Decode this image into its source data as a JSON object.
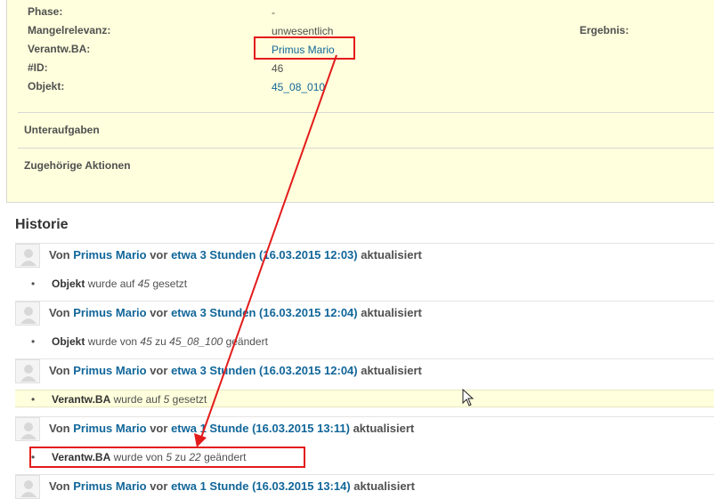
{
  "attributes": {
    "phase": {
      "label": "Phase:",
      "value": "-"
    },
    "mangelrelevanz": {
      "label": "Mangelrelevanz:",
      "value": "unwesentlich"
    },
    "ergebnis": {
      "label": "Ergebnis:"
    },
    "verantw": {
      "label": "Verantw.BA:",
      "value": "Primus Mario"
    },
    "id": {
      "label": "#ID:",
      "value": "46"
    },
    "objekt": {
      "label": "Objekt:",
      "value": "45_08_010"
    }
  },
  "sections": {
    "unteraufgaben": "Unteraufgaben",
    "zugehoerige_aktionen": "Zugehörige Aktionen"
  },
  "historie": {
    "title": "Historie",
    "entries": [
      {
        "prefix": "Von",
        "author": "Primus Mario",
        "mid": "vor",
        "time": "etwa 3 Stunden (16.03.2015 12:03)",
        "suffix": "aktualisiert",
        "detail": {
          "field": "Objekt",
          "pre": "wurde auf",
          "old": "",
          "mid": "",
          "new": "45",
          "post": "gesetzt"
        }
      },
      {
        "prefix": "Von",
        "author": "Primus Mario",
        "mid": "vor",
        "time": "etwa 3 Stunden (16.03.2015 12:04)",
        "suffix": "aktualisiert",
        "detail": {
          "field": "Objekt",
          "pre": "wurde von",
          "old": "45",
          "mid": "zu",
          "new": "45_08_100",
          "post": "geändert"
        }
      },
      {
        "prefix": "Von",
        "author": "Primus Mario",
        "mid": "vor",
        "time": "etwa 3 Stunden (16.03.2015 12:04)",
        "suffix": "aktualisiert",
        "detail": {
          "field": "Verantw.BA",
          "pre": "wurde auf",
          "old": "",
          "mid": "",
          "new": "5",
          "post": "gesetzt"
        }
      },
      {
        "prefix": "Von",
        "author": "Primus Mario",
        "mid": "vor",
        "time": "etwa 1 Stunde (16.03.2015 13:11)",
        "suffix": "aktualisiert",
        "detail": {
          "field": "Verantw.BA",
          "pre": "wurde von",
          "old": "5",
          "mid": "zu",
          "new": "22",
          "post": "geändert"
        }
      },
      {
        "prefix": "Von",
        "author": "Primus Mario",
        "mid": "vor",
        "time": "etwa 1 Stunde (16.03.2015 13:14)",
        "suffix": "aktualisiert"
      }
    ]
  },
  "colors": {
    "highlight_bg": "#ffffdd",
    "link": "#116699",
    "annotation_red": "#e31b1b"
  }
}
